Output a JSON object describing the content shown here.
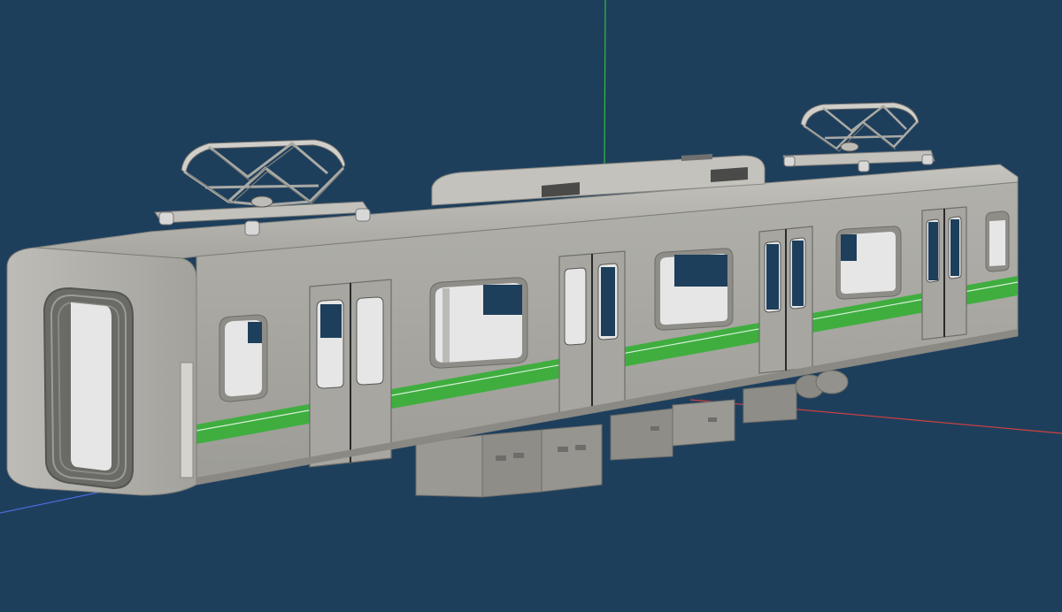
{
  "viewport": {
    "background": "#1e3f5c",
    "axis_colors": {
      "x": "#d04040",
      "y": "#2fbf3f",
      "z": "#4a6ad8"
    }
  },
  "model": {
    "body_color": "#a9a8a2",
    "stripe_color": "#3fae3f",
    "window_color": "#e6e6e6",
    "pantograph_color": "#c8c8c8",
    "underfloor_color": "#8e8d88",
    "cars": 1,
    "pantographs": 2
  }
}
